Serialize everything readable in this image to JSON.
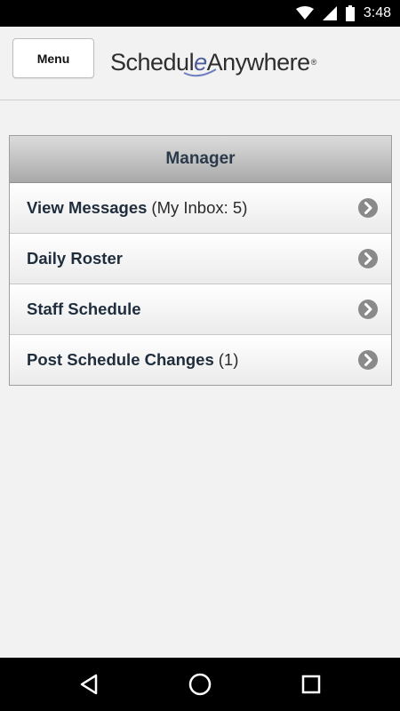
{
  "status_bar": {
    "time": "3:48"
  },
  "header": {
    "menu_label": "Menu",
    "logo": {
      "part1": "Schedul",
      "part2": "e",
      "part3": "Anywhere",
      "mark": "®"
    }
  },
  "panel": {
    "title": "Manager",
    "items": [
      {
        "label": "View Messages",
        "extra": "(My Inbox: 5)"
      },
      {
        "label": "Daily Roster",
        "extra": ""
      },
      {
        "label": "Staff Schedule",
        "extra": ""
      },
      {
        "label": "Post Schedule Changes",
        "extra": "(1)"
      }
    ]
  },
  "icons": {
    "status": [
      "wifi-icon",
      "signal-icon",
      "battery-icon"
    ],
    "row_chevron": "chevron-right-icon",
    "nav": [
      "back-icon",
      "home-icon",
      "recents-icon"
    ]
  },
  "colors": {
    "panel_title": "#2b3a4a",
    "row_text": "#1f2d3d",
    "chevron": "#8a8a8a"
  }
}
